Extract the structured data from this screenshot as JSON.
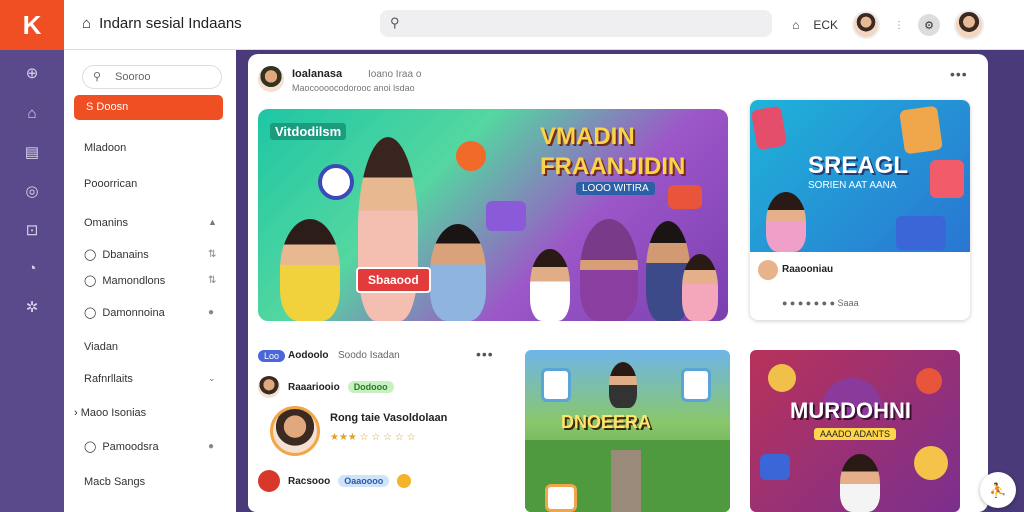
{
  "app": {
    "logo_text": "K",
    "title": "Indarn sesial Indaans",
    "title_icon": "home-icon"
  },
  "topbar": {
    "search_placeholder": "",
    "search_icon": "search-icon",
    "right": {
      "home_icon": "home-icon",
      "label": "ECK",
      "menu_icon": "menu-icon",
      "settings_icon": "gear-icon"
    }
  },
  "rail": {
    "icons": [
      "compass-icon",
      "home-icon",
      "library-icon",
      "globe-icon",
      "inbox-icon",
      "clock-icon",
      "settings-icon"
    ]
  },
  "sidebar": {
    "search_placeholder": "Sooroo",
    "active_item": "S Doosn",
    "items": [
      {
        "label": "Mladoon"
      },
      {
        "label": "Pooorrican"
      }
    ],
    "section1": "Omanins",
    "sub_items": [
      {
        "label": "Dbanains",
        "trail": "⇅"
      },
      {
        "label": "Mamondlons",
        "trail": "⇅"
      },
      {
        "label": "Damonnoina",
        "trail": "●"
      }
    ],
    "section2": "Viadan",
    "section3": "Rafnrllaits",
    "section4": "Maoo Isonias",
    "section5": "Pamoodsra",
    "section6": "Macb Sangs"
  },
  "feed": {
    "author": "Ioalanasa",
    "meta": "Ioano Iraa o",
    "subtitle": "Maocoooocodorooc anoi lsdao",
    "more_icon": "more-icon"
  },
  "banner": {
    "tag": "Vitdodilsm",
    "headline1": "VMADIN",
    "headline2": "FRAANJIDIN",
    "subtitle": "LOOO WITIRA",
    "button": "Sbaaood"
  },
  "card2": {
    "headline": "SREAGL",
    "subheadline": "SORIEN AAT AANA",
    "caption": "Raaooniau",
    "rating": "● ● ● ● ● ● ● Saaa"
  },
  "post": {
    "tag": "Loo",
    "title": "Aodoolo",
    "meta": "Soodo Isadan",
    "rows": [
      {
        "name": "Raaariooio",
        "chip": "Dodooo"
      },
      {
        "name": "Rong taie Vasoldolaan",
        "rating": "★★★ ☆ ☆ ☆ ☆ ☆"
      },
      {
        "name": "Racsooo",
        "chip": "Oaaoooo"
      }
    ]
  },
  "tile3": {
    "label": "DNOEERA"
  },
  "tile4": {
    "headline": "MURDOHNI",
    "subheadline": "AAADO ADANTS"
  },
  "fab": {
    "icon": "user-icon"
  },
  "colors": {
    "brand": "#f04e23",
    "rail": "#5a4a8c",
    "bg": "#4a3a7a"
  }
}
